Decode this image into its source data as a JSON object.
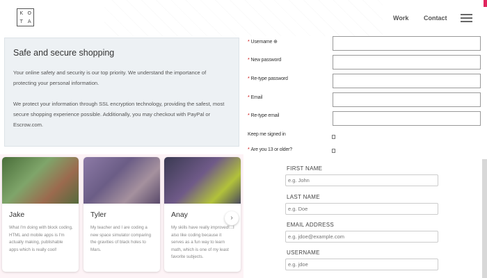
{
  "header": {
    "logo_letters": [
      "K",
      "O",
      "T",
      "A"
    ],
    "nav": {
      "work": "Work",
      "contact": "Contact"
    },
    "menu_icon": "hamburger-menu-icon",
    "accent_color": "#e0245e"
  },
  "info": {
    "title": "Safe and secure shopping",
    "paragraph1": "Your online safety and security is our top priority. We understand the importance of protecting your personal information.",
    "paragraph2": "We protect your information through SSL encryption technology, providing the safest, most secure shopping experience possible. Additionally, you may checkout with PayPal or Escrow.com."
  },
  "cards": [
    {
      "name": "Jake",
      "text": "What I'm doing with block coding, HTML and mobile apps is I'm actually making, publishable apps which is really cool!"
    },
    {
      "name": "Tyler",
      "text": "My teacher and I are coding a new space simulator comparing the gravities of black holes to Mars."
    },
    {
      "name": "Anay",
      "text": "My skills have really improved!...I also like coding because it serves as a fun way to learn math, which is one of my least favorite subjects."
    }
  ],
  "next_icon": "chevron-right-icon",
  "registration": {
    "required_mark": "*",
    "username": "Username",
    "username_help_icon": "⊕",
    "new_password": "New password",
    "retype_password": "Re-type password",
    "email": "Email",
    "retype_email": "Re-type email",
    "keep_signed_in": "Keep me signed in",
    "age_check": "Are you 13 or older?"
  },
  "signup": {
    "first_name_label": "FIRST NAME",
    "first_name_placeholder": "e.g. John",
    "last_name_label": "LAST NAME",
    "last_name_placeholder": "e.g. Doe",
    "email_label": "EMAIL ADDRESS",
    "email_placeholder": "e.g. jdoe@example.com",
    "username_label": "USERNAME",
    "username_placeholder": "e.g. jdoe"
  }
}
